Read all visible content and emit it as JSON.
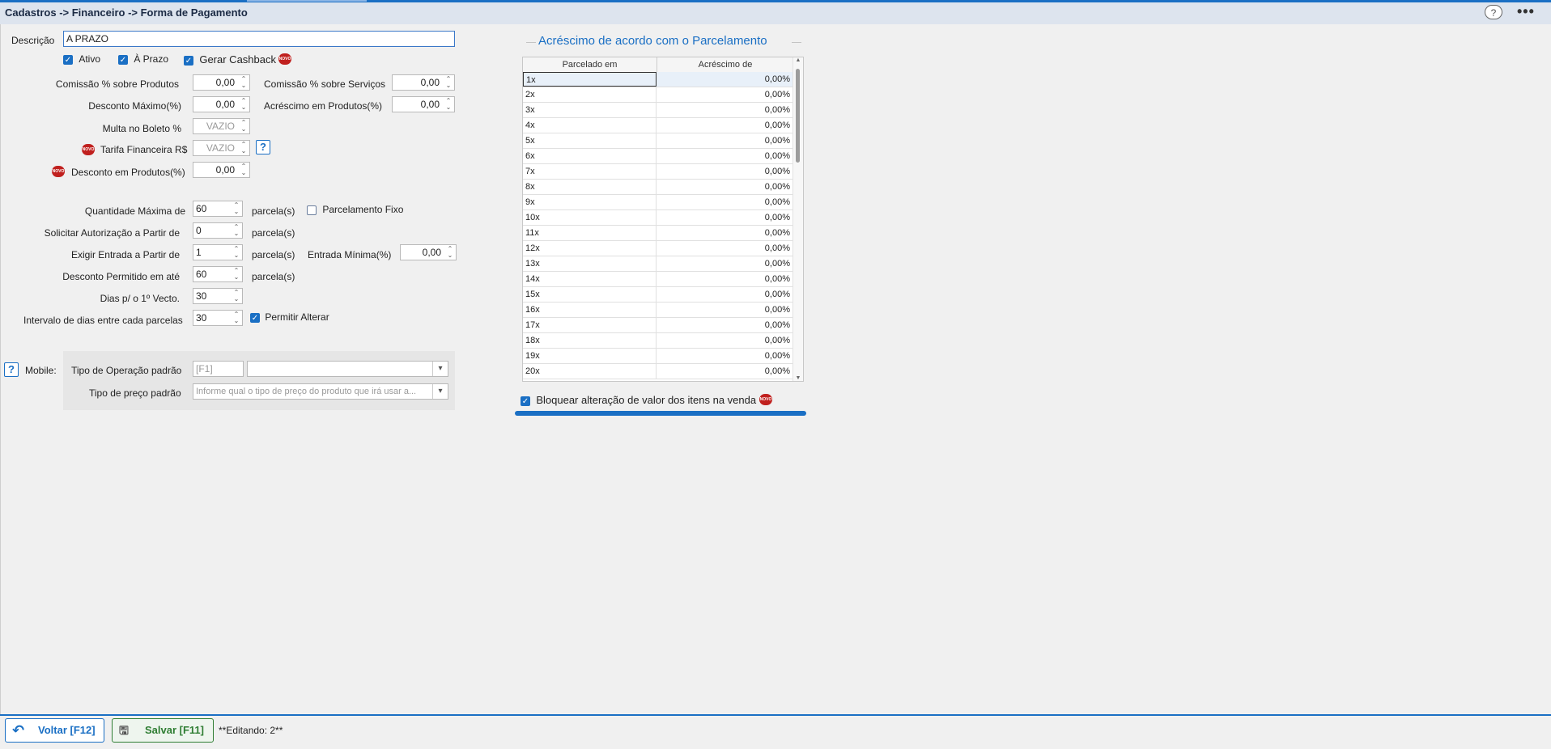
{
  "header": {
    "breadcrumb": "Cadastros -> Financeiro -> Forma de Pagamento",
    "help_icon": "question-circle-icon",
    "more_icon": "ellipsis-icon",
    "more_label": "•••"
  },
  "form": {
    "descricao_label": "Descrição",
    "descricao_value": "A PRAZO",
    "ativo_label": "Ativo",
    "aprazo_label": "À Prazo",
    "cashback_label": "Gerar Cashback",
    "novo_badge": "NOVO",
    "comissao_produtos_label": "Comissão % sobre Produtos",
    "comissao_produtos_value": "0,00",
    "comissao_servicos_label": "Comissão % sobre Serviços",
    "comissao_servicos_value": "0,00",
    "desconto_maximo_label": "Desconto Máximo(%)",
    "desconto_maximo_value": "0,00",
    "acrescimo_produtos_label": "Acréscimo em Produtos(%)",
    "acrescimo_produtos_value": "0,00",
    "multa_boleto_label": "Multa no Boleto %",
    "multa_boleto_value": "VAZIO",
    "tarifa_label": "Tarifa Financeira R$",
    "tarifa_value": "VAZIO",
    "desconto_produtos_label": "Desconto em Produtos(%)",
    "desconto_produtos_value": "0,00",
    "qtd_maxima_label": "Quantidade Máxima de",
    "qtd_maxima_value": "60",
    "parcelas_unit": "parcela(s)",
    "parcelamento_fixo_label": "Parcelamento Fixo",
    "solicitar_autorizacao_label": "Solicitar Autorização a Partir de",
    "solicitar_autorizacao_value": "0",
    "exigir_entrada_label": "Exigir Entrada a Partir de",
    "exigir_entrada_value": "1",
    "entrada_minima_label": "Entrada Mínima(%)",
    "entrada_minima_value": "0,00",
    "desconto_permitido_label": "Desconto Permitido em até",
    "desconto_permitido_value": "60",
    "dias_vecto_label": "Dias p/ o 1º Vecto.",
    "dias_vecto_value": "30",
    "intervalo_label": "Intervalo de dias entre cada parcelas",
    "intervalo_value": "30",
    "permitir_alterar_label": "Permitir Alterar"
  },
  "mobile": {
    "label": "Mobile:",
    "tipo_operacao_label": "Tipo de Operação padrão",
    "tipo_operacao_code": "[F1]",
    "tipo_operacao_value": "",
    "tipo_preco_label": "Tipo de preço padrão",
    "tipo_preco_placeholder": "Informe qual o tipo de preço do produto que irá usar a..."
  },
  "parcelamento": {
    "title": "Acréscimo de acordo com o Parcelamento",
    "col_parcelado": "Parcelado em",
    "col_acrescimo": "Acréscimo de",
    "rows": [
      {
        "parcela": "1x",
        "acrescimo": "0,00%"
      },
      {
        "parcela": "2x",
        "acrescimo": "0,00%"
      },
      {
        "parcela": "3x",
        "acrescimo": "0,00%"
      },
      {
        "parcela": "4x",
        "acrescimo": "0,00%"
      },
      {
        "parcela": "5x",
        "acrescimo": "0,00%"
      },
      {
        "parcela": "6x",
        "acrescimo": "0,00%"
      },
      {
        "parcela": "7x",
        "acrescimo": "0,00%"
      },
      {
        "parcela": "8x",
        "acrescimo": "0,00%"
      },
      {
        "parcela": "9x",
        "acrescimo": "0,00%"
      },
      {
        "parcela": "10x",
        "acrescimo": "0,00%"
      },
      {
        "parcela": "11x",
        "acrescimo": "0,00%"
      },
      {
        "parcela": "12x",
        "acrescimo": "0,00%"
      },
      {
        "parcela": "13x",
        "acrescimo": "0,00%"
      },
      {
        "parcela": "14x",
        "acrescimo": "0,00%"
      },
      {
        "parcela": "15x",
        "acrescimo": "0,00%"
      },
      {
        "parcela": "16x",
        "acrescimo": "0,00%"
      },
      {
        "parcela": "17x",
        "acrescimo": "0,00%"
      },
      {
        "parcela": "18x",
        "acrescimo": "0,00%"
      },
      {
        "parcela": "19x",
        "acrescimo": "0,00%"
      },
      {
        "parcela": "20x",
        "acrescimo": "0,00%"
      }
    ],
    "bloquear_label": "Bloquear alteração de valor dos itens na venda"
  },
  "footer": {
    "voltar_label": "Voltar [F12]",
    "salvar_label": "Salvar [F11]",
    "status": "**Editando: 2**"
  },
  "colors": {
    "accent": "#1a6fc4",
    "save": "#2e7d32",
    "novo_badge": "#c0201e"
  }
}
